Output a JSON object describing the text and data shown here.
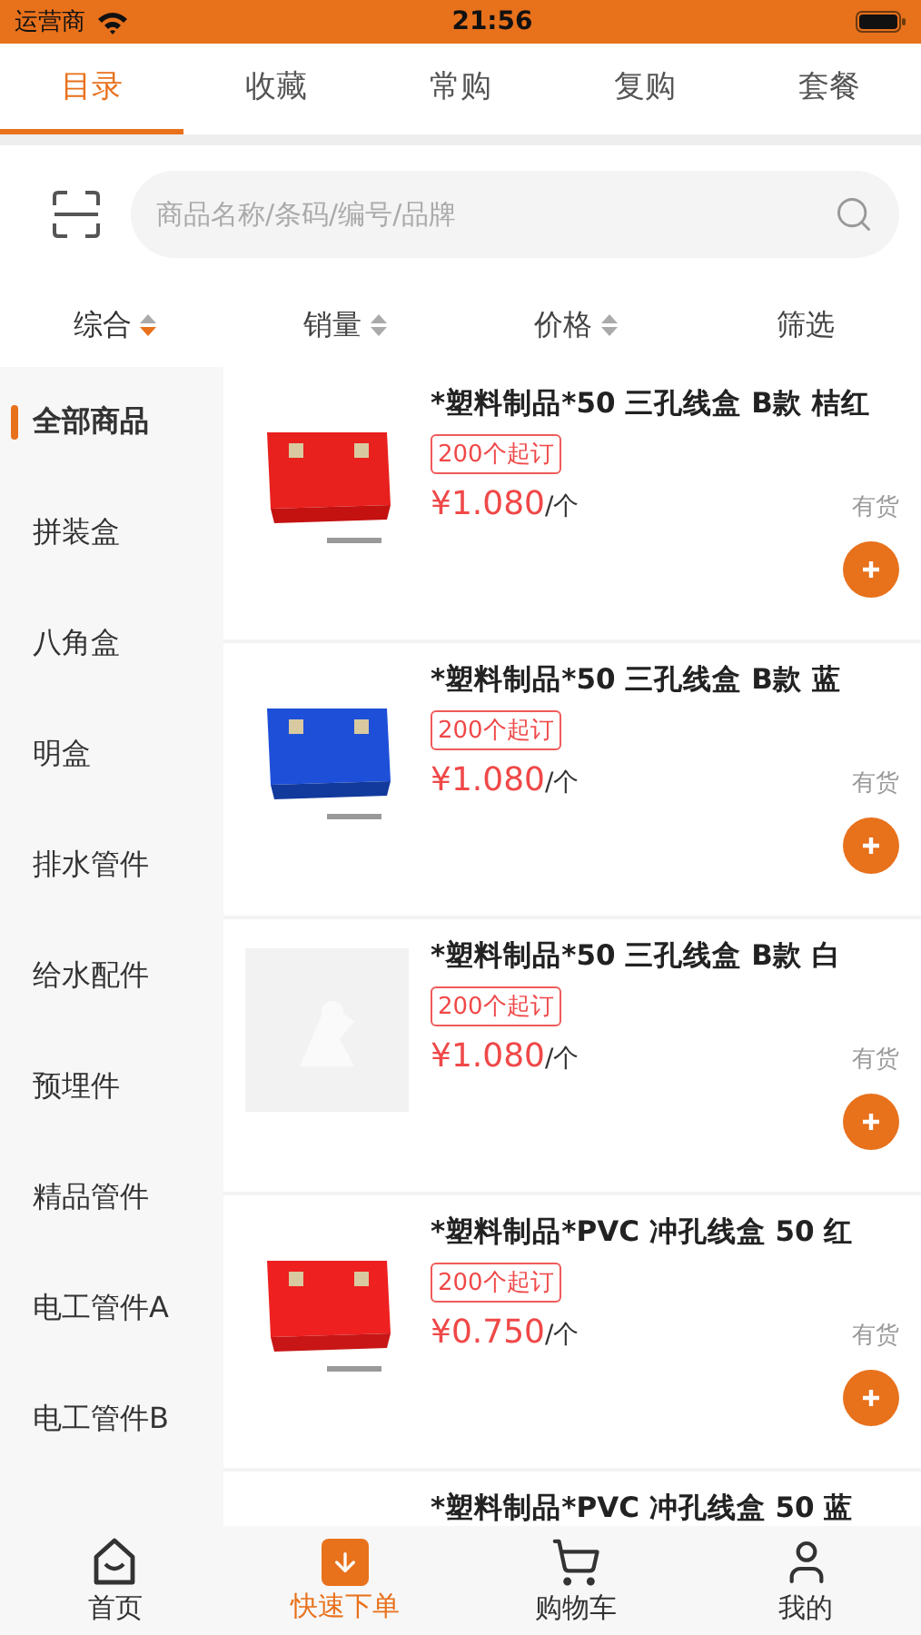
{
  "status_bar": {
    "carrier": "运营商",
    "time": "21:56"
  },
  "tabs": [
    {
      "label": "目录",
      "selected": true
    },
    {
      "label": "收藏",
      "selected": false
    },
    {
      "label": "常购",
      "selected": false
    },
    {
      "label": "复购",
      "selected": false
    },
    {
      "label": "套餐",
      "selected": false
    }
  ],
  "search": {
    "placeholder": "商品名称/条码/编号/品牌"
  },
  "sort_options": [
    {
      "label": "综合",
      "kind": "sort",
      "selected": true
    },
    {
      "label": "销量",
      "kind": "sort",
      "selected": false
    },
    {
      "label": "价格",
      "kind": "sort",
      "selected": false
    },
    {
      "label": "筛选",
      "kind": "filter",
      "selected": false
    }
  ],
  "categories": [
    {
      "label": "全部商品",
      "selected": true
    },
    {
      "label": "拼装盒",
      "selected": false
    },
    {
      "label": "八角盒",
      "selected": false
    },
    {
      "label": "明盒",
      "selected": false
    },
    {
      "label": "排水管件",
      "selected": false
    },
    {
      "label": "给水配件",
      "selected": false
    },
    {
      "label": "预埋件",
      "selected": false
    },
    {
      "label": "精品管件",
      "selected": false
    },
    {
      "label": "电工管件A",
      "selected": false
    },
    {
      "label": "电工管件B",
      "selected": false
    }
  ],
  "products": [
    {
      "title": "*塑料制品*50 三孔线盒 B款 桔红",
      "min_order": "200个起订",
      "price": "¥1.080",
      "unit": "/个",
      "stock": "有货"
    },
    {
      "title": "*塑料制品*50 三孔线盒 B款 蓝",
      "min_order": "200个起订",
      "price": "¥1.080",
      "unit": "/个",
      "stock": "有货"
    },
    {
      "title": "*塑料制品*50 三孔线盒 B款 白",
      "min_order": "200个起订",
      "price": "¥1.080",
      "unit": "/个",
      "stock": "有货"
    },
    {
      "title": "*塑料制品*PVC 冲孔线盒 50 红",
      "min_order": "200个起订",
      "price": "¥0.750",
      "unit": "/个",
      "stock": "有货"
    },
    {
      "title": "*塑料制品*PVC 冲孔线盒 50 蓝"
    }
  ],
  "bottom_nav": [
    {
      "label": "首页",
      "kind": "home",
      "selected": false
    },
    {
      "label": "快速下单",
      "kind": "quick",
      "selected": true
    },
    {
      "label": "购物车",
      "kind": "cart",
      "selected": false
    },
    {
      "label": "我的",
      "kind": "user",
      "selected": false
    }
  ]
}
